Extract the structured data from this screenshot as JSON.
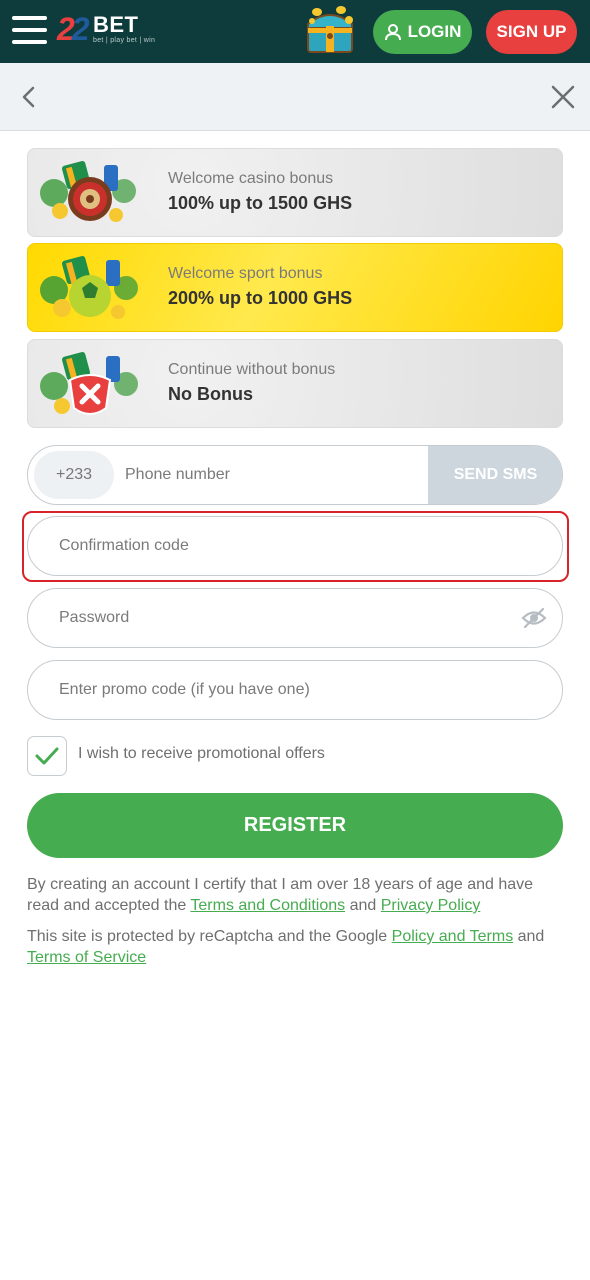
{
  "header": {
    "logo_num_1": "2",
    "logo_num_2": "2",
    "logo_text": "BET",
    "logo_tagline": "bet | play bet | win",
    "login_label": "LOGIN",
    "signup_label": "SIGN UP"
  },
  "bonuses": [
    {
      "subtitle": "Welcome casino bonus",
      "title": "100% up to 1500 GHS"
    },
    {
      "subtitle": "Welcome sport bonus",
      "title": "200% up to 1000 GHS"
    },
    {
      "subtitle": "Continue without bonus",
      "title": "No Bonus"
    }
  ],
  "form": {
    "phone_prefix": "+233",
    "phone_placeholder": "Phone number",
    "send_sms_label": "SEND SMS",
    "code_placeholder": "Confirmation code",
    "password_placeholder": "Password",
    "promo_placeholder": "Enter promo code (if you have one)",
    "promo_checkbox_label": "I wish to receive promotional offers",
    "register_label": "REGISTER"
  },
  "legal": {
    "line1_prefix": "By creating an account I certify that I am over 18 years of age and have read and accepted the ",
    "terms_link": "Terms and Conditions",
    "and_1": " and ",
    "privacy_link": "Privacy Policy",
    "line2_prefix": "This site is protected by reCaptcha and the Google ",
    "policy_terms_link": "Policy and Terms",
    "and_2": " and ",
    "tos_link": "Terms of Service"
  },
  "colors": {
    "header_bg": "#0e3b3c",
    "accent_green": "#46ac50",
    "accent_red": "#e8403f",
    "highlight_red": "#d8232a",
    "sport_yellow": "#ffd900"
  },
  "icons": [
    "menu-icon",
    "treasure-chest-icon",
    "user-icon",
    "back-chevron-icon",
    "close-icon",
    "eye-slash-icon",
    "checkmark-icon"
  ]
}
